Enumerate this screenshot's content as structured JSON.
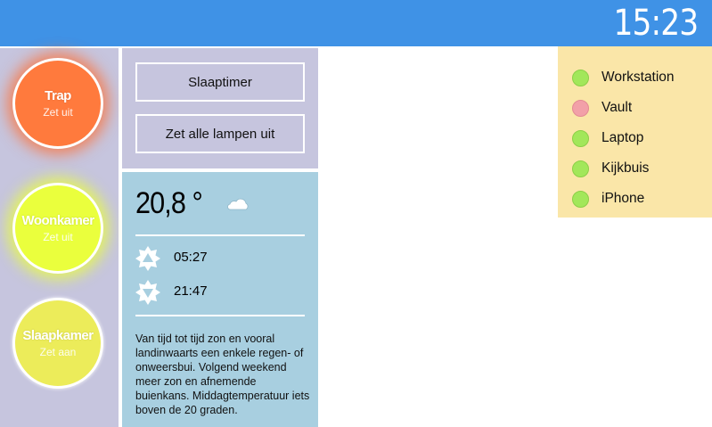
{
  "header": {
    "clock": "15:23",
    "color": "#3f92e6"
  },
  "lamps": [
    {
      "name": "Trap",
      "state": "Zet uit",
      "color": "#ff7a3d",
      "on": true
    },
    {
      "name": "Woonkamer",
      "state": "Zet uit",
      "color": "#eaff3d",
      "on": true
    },
    {
      "name": "Slaapkamer",
      "state": "Zet aan",
      "color": "#ecec5a",
      "on": false
    }
  ],
  "controls": {
    "sleep_timer_label": "Slaaptimer",
    "all_off_label": "Zet alle lampen uit"
  },
  "weather": {
    "temperature": "20,8 °",
    "condition_icon": "cloud-icon",
    "sunrise": "05:27",
    "sunset": "21:47",
    "forecast": "Van tijd tot tijd zon en vooral landinwaarts een enkele regen- of onweersbui. Volgend weekend meer zon en afnemende buienkans. Middagtemperatuur iets boven de 20 graden."
  },
  "devices": [
    {
      "name": "Workstation",
      "status": "online"
    },
    {
      "name": "Vault",
      "status": "offline"
    },
    {
      "name": "Laptop",
      "status": "online"
    },
    {
      "name": "Kijkbuis",
      "status": "online"
    },
    {
      "name": "iPhone",
      "status": "online"
    }
  ]
}
